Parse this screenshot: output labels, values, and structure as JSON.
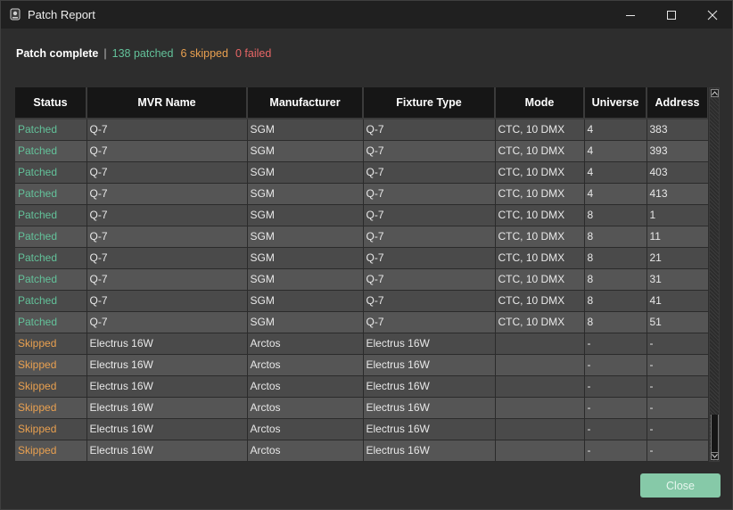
{
  "window": {
    "title": "Patch Report",
    "icon": "app-icon"
  },
  "summary": {
    "label": "Patch complete",
    "separator": "|",
    "patched": "138 patched",
    "skipped": "6 skipped",
    "failed": "0 failed"
  },
  "colors": {
    "patched": "#63c29a",
    "skipped": "#e9a050",
    "failed": "#e86666",
    "accent": "#86c9a8"
  },
  "table": {
    "columns": [
      "Status",
      "MVR Name",
      "Manufacturer",
      "Fixture Type",
      "Mode",
      "Universe",
      "Address"
    ],
    "rows": [
      [
        "Patched",
        "Q-7",
        "SGM",
        "Q-7",
        "CTC, 10 DMX",
        "4",
        "383"
      ],
      [
        "Patched",
        "Q-7",
        "SGM",
        "Q-7",
        "CTC, 10 DMX",
        "4",
        "393"
      ],
      [
        "Patched",
        "Q-7",
        "SGM",
        "Q-7",
        "CTC, 10 DMX",
        "4",
        "403"
      ],
      [
        "Patched",
        "Q-7",
        "SGM",
        "Q-7",
        "CTC, 10 DMX",
        "4",
        "413"
      ],
      [
        "Patched",
        "Q-7",
        "SGM",
        "Q-7",
        "CTC, 10 DMX",
        "8",
        "1"
      ],
      [
        "Patched",
        "Q-7",
        "SGM",
        "Q-7",
        "CTC, 10 DMX",
        "8",
        "11"
      ],
      [
        "Patched",
        "Q-7",
        "SGM",
        "Q-7",
        "CTC, 10 DMX",
        "8",
        "21"
      ],
      [
        "Patched",
        "Q-7",
        "SGM",
        "Q-7",
        "CTC, 10 DMX",
        "8",
        "31"
      ],
      [
        "Patched",
        "Q-7",
        "SGM",
        "Q-7",
        "CTC, 10 DMX",
        "8",
        "41"
      ],
      [
        "Patched",
        "Q-7",
        "SGM",
        "Q-7",
        "CTC, 10 DMX",
        "8",
        "51"
      ],
      [
        "Skipped",
        "Electrus 16W",
        "Arctos",
        "Electrus 16W",
        "",
        "-",
        "-"
      ],
      [
        "Skipped",
        "Electrus 16W",
        "Arctos",
        "Electrus 16W",
        "",
        "-",
        "-"
      ],
      [
        "Skipped",
        "Electrus 16W",
        "Arctos",
        "Electrus 16W",
        "",
        "-",
        "-"
      ],
      [
        "Skipped",
        "Electrus 16W",
        "Arctos",
        "Electrus 16W",
        "",
        "-",
        "-"
      ],
      [
        "Skipped",
        "Electrus 16W",
        "Arctos",
        "Electrus 16W",
        "",
        "-",
        "-"
      ],
      [
        "Skipped",
        "Electrus 16W",
        "Arctos",
        "Electrus 16W",
        "",
        "-",
        "-"
      ]
    ]
  },
  "footer": {
    "close_label": "Close"
  }
}
